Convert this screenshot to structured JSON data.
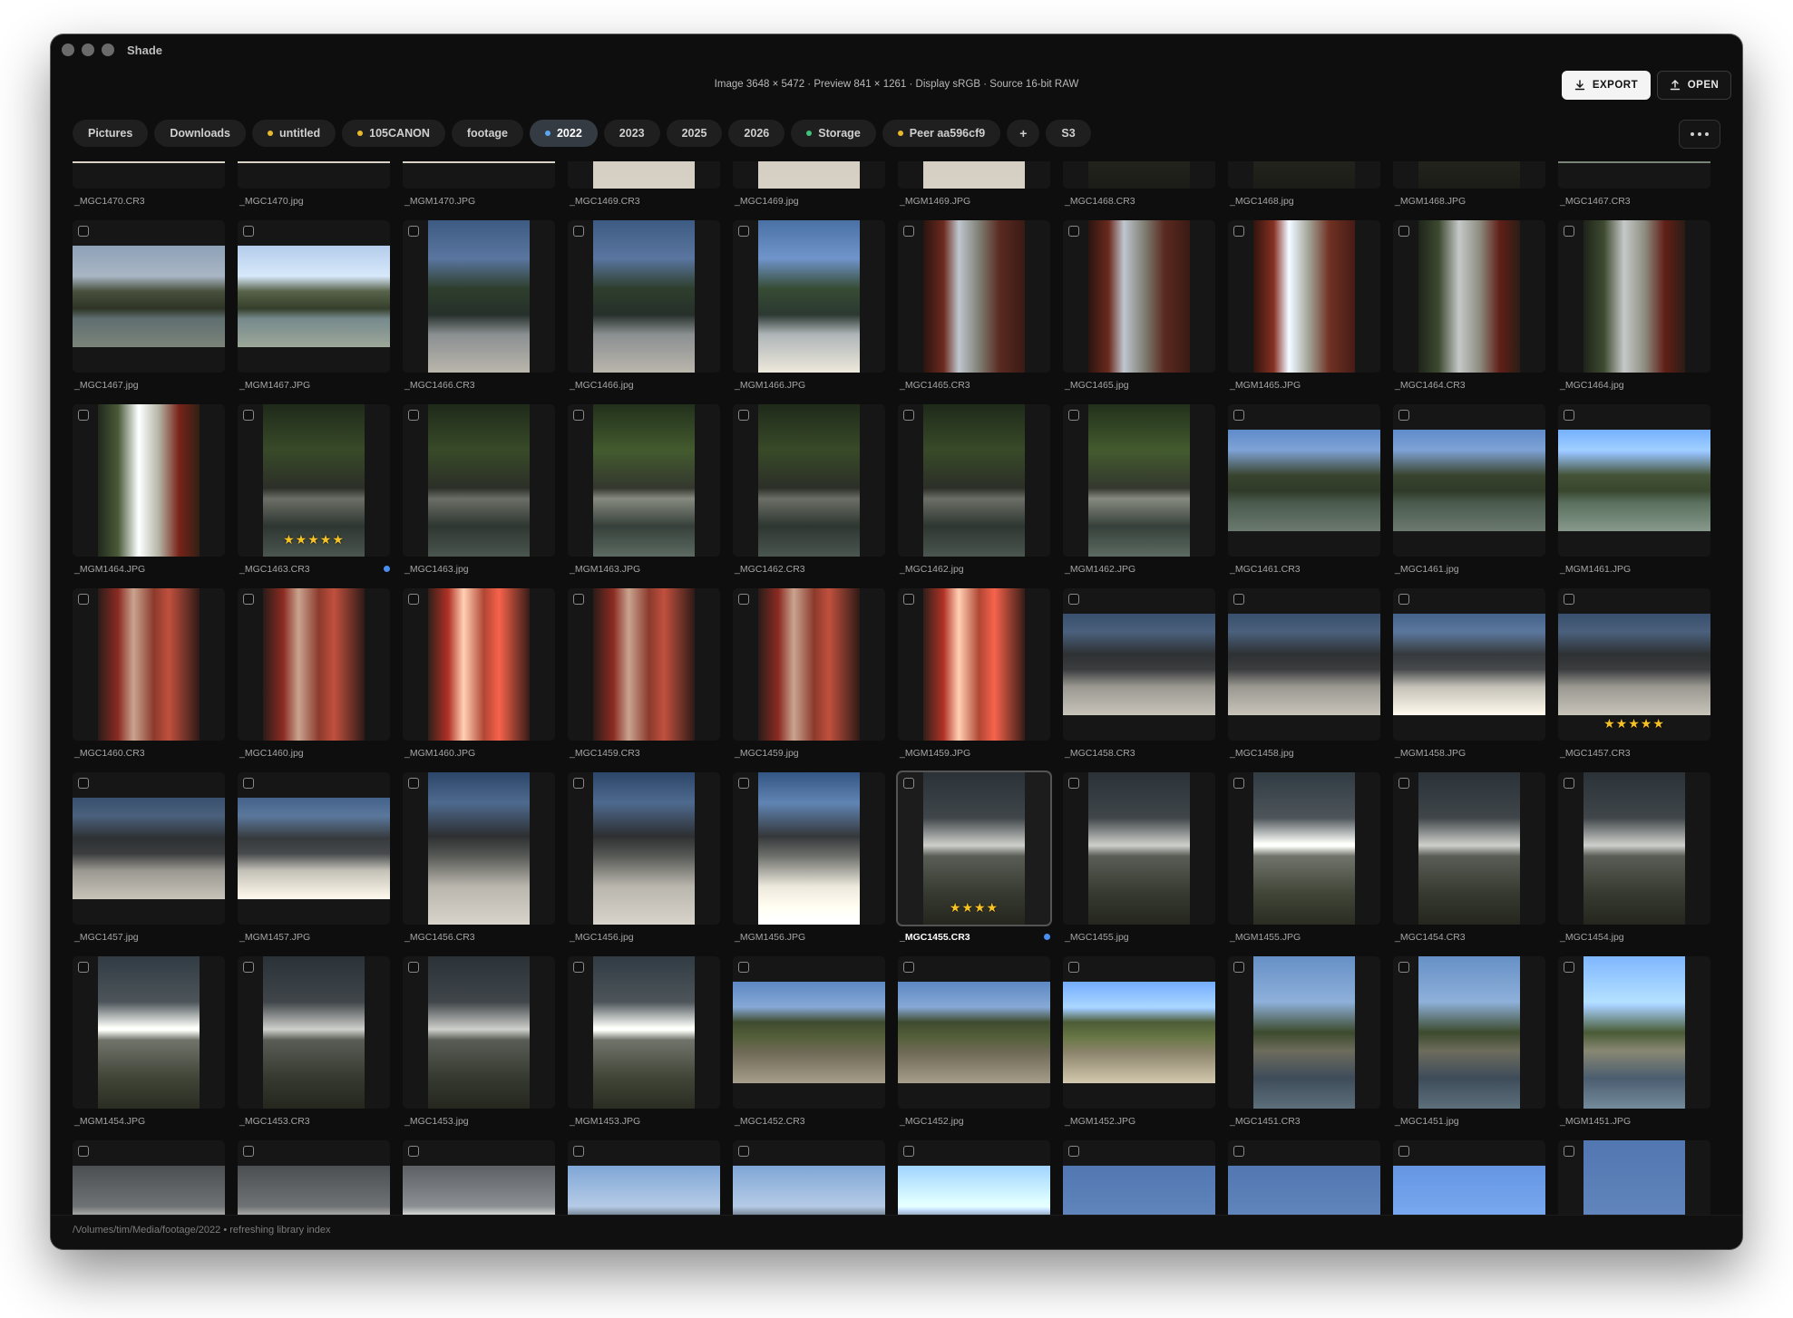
{
  "app": {
    "title": "Shade"
  },
  "info": {
    "text": "Image 3648 × 5472 · Preview 841 × 1261 · Display sRGB · Source 16-bit RAW"
  },
  "toolbar": {
    "export_label": "EXPORT",
    "open_label": "OPEN"
  },
  "tabs": [
    {
      "label": "Pictures",
      "dot": "",
      "active": false
    },
    {
      "label": "Downloads",
      "dot": "",
      "active": false
    },
    {
      "label": "untitled",
      "dot": "yellow",
      "active": false
    },
    {
      "label": "105CANON",
      "dot": "yellow",
      "active": false
    },
    {
      "label": "footage",
      "dot": "",
      "active": false
    },
    {
      "label": "2022",
      "dot": "blue",
      "active": true
    },
    {
      "label": "2023",
      "dot": "",
      "active": false
    },
    {
      "label": "2025",
      "dot": "",
      "active": false
    },
    {
      "label": "2026",
      "dot": "",
      "active": false
    },
    {
      "label": "Storage",
      "dot": "green",
      "active": false
    },
    {
      "label": "Peer aa596cf9",
      "dot": "yellow",
      "active": false
    },
    {
      "label": "+",
      "dot": "",
      "active": false
    },
    {
      "label": "S3",
      "dot": "",
      "active": false
    }
  ],
  "colors": {
    "accent": "#4a8ff0",
    "star": "#f7c224",
    "tab_dot_yellow": "#e9b92c",
    "tab_dot_green": "#3fc47a"
  },
  "grid": {
    "rows": [
      {
        "items": [
          {
            "name": "_MGC1470.CR3",
            "theme": "bridge",
            "orient": "l"
          },
          {
            "name": "_MGC1470.jpg",
            "theme": "bridge",
            "orient": "l"
          },
          {
            "name": "_MGM1470.JPG",
            "theme": "bridge",
            "orient": "l"
          },
          {
            "name": "_MGC1469.CR3",
            "theme": "bridge",
            "orient": "p"
          },
          {
            "name": "_MGC1469.jpg",
            "theme": "bridge",
            "orient": "p"
          },
          {
            "name": "_MGM1469.JPG",
            "theme": "bridge",
            "orient": "p"
          },
          {
            "name": "_MGC1468.CR3",
            "theme": "dark",
            "orient": "p"
          },
          {
            "name": "_MGC1468.jpg",
            "theme": "dark",
            "orient": "p"
          },
          {
            "name": "_MGM1468.JPG",
            "theme": "dark",
            "orient": "p"
          },
          {
            "name": "_MGC1467.CR3",
            "theme": "pond",
            "orient": "l"
          }
        ]
      },
      {
        "items": [
          {
            "name": "_MGC1467.jpg",
            "theme": "pond",
            "orient": "l"
          },
          {
            "name": "_MGM1467.JPG",
            "theme": "pondbright",
            "orient": "l"
          },
          {
            "name": "_MGC1466.CR3",
            "theme": "mountain",
            "orient": "p"
          },
          {
            "name": "_MGC1466.jpg",
            "theme": "mountain",
            "orient": "p"
          },
          {
            "name": "_MGM1466.JPG",
            "theme": "mountainbright",
            "orient": "p"
          },
          {
            "name": "_MGC1465.CR3",
            "theme": "arch",
            "orient": "p"
          },
          {
            "name": "_MGC1465.jpg",
            "theme": "arch",
            "orient": "p"
          },
          {
            "name": "_MGM1465.JPG",
            "theme": "archbright",
            "orient": "p"
          },
          {
            "name": "_MGC1464.CR3",
            "theme": "doorway",
            "orient": "p"
          },
          {
            "name": "_MGC1464.jpg",
            "theme": "doorway",
            "orient": "p"
          }
        ]
      },
      {
        "items": [
          {
            "name": "_MGM1464.JPG",
            "theme": "doorwaybright",
            "orient": "p"
          },
          {
            "name": "_MGC1463.CR3",
            "theme": "pavilion",
            "orient": "p",
            "stars": "★★★★★",
            "flag": true
          },
          {
            "name": "_MGC1463.jpg",
            "theme": "pavilion",
            "orient": "p"
          },
          {
            "name": "_MGM1463.JPG",
            "theme": "pavilionbright",
            "orient": "p"
          },
          {
            "name": "_MGC1462.CR3",
            "theme": "pavilion",
            "orient": "p"
          },
          {
            "name": "_MGC1462.jpg",
            "theme": "pavilion",
            "orient": "p"
          },
          {
            "name": "_MGM1462.JPG",
            "theme": "pavilionbright",
            "orient": "p"
          },
          {
            "name": "_MGC1461.CR3",
            "theme": "lake",
            "orient": "l"
          },
          {
            "name": "_MGC1461.jpg",
            "theme": "lake",
            "orient": "l"
          },
          {
            "name": "_MGM1461.JPG",
            "theme": "lakebright",
            "orient": "l"
          }
        ]
      },
      {
        "items": [
          {
            "name": "_MGC1460.CR3",
            "theme": "redgate",
            "orient": "p"
          },
          {
            "name": "_MGC1460.jpg",
            "theme": "redgate",
            "orient": "p"
          },
          {
            "name": "_MGM1460.JPG",
            "theme": "redgatebright",
            "orient": "p"
          },
          {
            "name": "_MGC1459.CR3",
            "theme": "redgate",
            "orient": "p"
          },
          {
            "name": "_MGC1459.jpg",
            "theme": "redgate",
            "orient": "p"
          },
          {
            "name": "_MGM1459.JPG",
            "theme": "redgatebright",
            "orient": "p"
          },
          {
            "name": "_MGC1458.CR3",
            "theme": "hall",
            "orient": "l"
          },
          {
            "name": "_MGC1458.jpg",
            "theme": "hall",
            "orient": "l"
          },
          {
            "name": "_MGM1458.JPG",
            "theme": "hallbright",
            "orient": "l"
          },
          {
            "name": "_MGC1457.CR3",
            "theme": "hall",
            "orient": "l",
            "stars": "★★★★★"
          }
        ]
      },
      {
        "items": [
          {
            "name": "_MGC1457.jpg",
            "theme": "hall",
            "orient": "l"
          },
          {
            "name": "_MGM1457.JPG",
            "theme": "hallbright",
            "orient": "l"
          },
          {
            "name": "_MGC1456.CR3",
            "theme": "plaza",
            "orient": "p"
          },
          {
            "name": "_MGC1456.jpg",
            "theme": "plaza",
            "orient": "p"
          },
          {
            "name": "_MGM1456.JPG",
            "theme": "plazabright",
            "orient": "p"
          },
          {
            "name": "_MGC1455.CR3",
            "theme": "wall",
            "orient": "p",
            "stars": "★★★★",
            "flag": true,
            "selected": true
          },
          {
            "name": "_MGC1455.jpg",
            "theme": "wall",
            "orient": "p"
          },
          {
            "name": "_MGM1455.JPG",
            "theme": "wallbright",
            "orient": "p"
          },
          {
            "name": "_MGC1454.CR3",
            "theme": "wall",
            "orient": "p"
          },
          {
            "name": "_MGC1454.jpg",
            "theme": "wall",
            "orient": "p"
          }
        ]
      },
      {
        "items": [
          {
            "name": "_MGM1454.JPG",
            "theme": "wallbright",
            "orient": "p"
          },
          {
            "name": "_MGC1453.CR3",
            "theme": "wall",
            "orient": "p"
          },
          {
            "name": "_MGC1453.jpg",
            "theme": "wall",
            "orient": "p"
          },
          {
            "name": "_MGM1453.JPG",
            "theme": "wallbright",
            "orient": "p"
          },
          {
            "name": "_MGC1452.CR3",
            "theme": "stream",
            "orient": "l"
          },
          {
            "name": "_MGC1452.jpg",
            "theme": "stream",
            "orient": "l"
          },
          {
            "name": "_MGM1452.JPG",
            "theme": "streambright",
            "orient": "l"
          },
          {
            "name": "_MGC1451.CR3",
            "theme": "canal",
            "orient": "p"
          },
          {
            "name": "_MGC1451.jpg",
            "theme": "canal",
            "orient": "p"
          },
          {
            "name": "_MGM1451.JPG",
            "theme": "canalbright",
            "orient": "p"
          }
        ]
      },
      {
        "items": [
          {
            "name": "",
            "theme": "roof",
            "orient": "l"
          },
          {
            "name": "",
            "theme": "roof",
            "orient": "l"
          },
          {
            "name": "",
            "theme": "roofbright",
            "orient": "l"
          },
          {
            "name": "",
            "theme": "sky",
            "orient": "l"
          },
          {
            "name": "",
            "theme": "sky",
            "orient": "l"
          },
          {
            "name": "",
            "theme": "skybright",
            "orient": "l"
          },
          {
            "name": "",
            "theme": "blue",
            "orient": "l"
          },
          {
            "name": "",
            "theme": "blue",
            "orient": "l"
          },
          {
            "name": "",
            "theme": "bluebright",
            "orient": "l"
          },
          {
            "name": "",
            "theme": "blue",
            "orient": "p"
          }
        ]
      }
    ]
  },
  "status": {
    "text": "/Volumes/tim/Media/footage/2022 • refreshing library index"
  }
}
